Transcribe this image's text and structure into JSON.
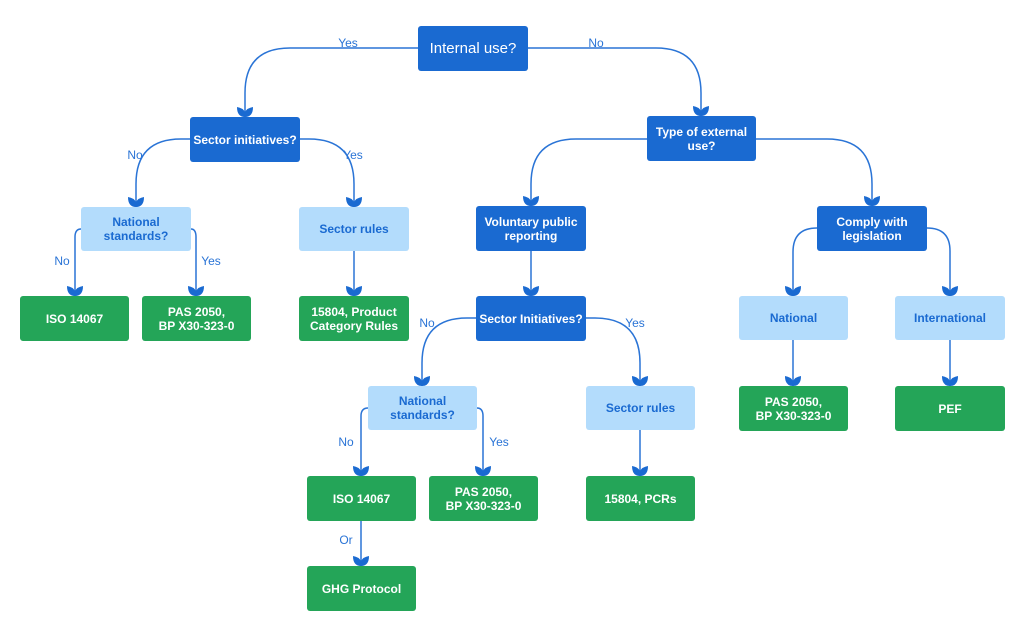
{
  "colors": {
    "question": "#1a6ad1",
    "category": "#b3dcfc",
    "category_text": "#1a6ad1",
    "result": "#24a558",
    "connector": "#2a74d6"
  },
  "nodes": {
    "internal_use": "Internal use?",
    "sector_initiatives_internal": "Sector initiatives?",
    "national_standards_internal": "National\nstandards?",
    "sector_rules_internal": "Sector rules",
    "iso_internal": "ISO 14067",
    "pas_internal": "PAS 2050,\nBP X30-323-0",
    "pcr_internal": "15804, Product\nCategory Rules",
    "type_external": "Type of external\nuse?",
    "voluntary_reporting": "Voluntary public\nreporting",
    "sector_initiatives_external": "Sector Initiatives?",
    "national_standards_external": "National\nstandards?",
    "sector_rules_external": "Sector rules",
    "iso_external": "ISO 14067",
    "pas_external": "PAS 2050,\nBP X30-323-0",
    "pcr_external": "15804, PCRs",
    "ghg_protocol": "GHG Protocol",
    "comply_legislation": "Comply with\nlegislation",
    "national": "National",
    "international": "International",
    "pas_national": "PAS 2050,\nBP X30-323-0",
    "pef": "PEF"
  },
  "edge_labels": {
    "internal_yes": "Yes",
    "internal_no": "No",
    "sector_int_no": "No",
    "sector_int_yes": "Yes",
    "natstd_int_no": "No",
    "natstd_int_yes": "Yes",
    "sector_ext_no": "No",
    "sector_ext_yes": "Yes",
    "natstd_ext_no": "No",
    "natstd_ext_yes": "Yes",
    "iso_or": "Or"
  }
}
